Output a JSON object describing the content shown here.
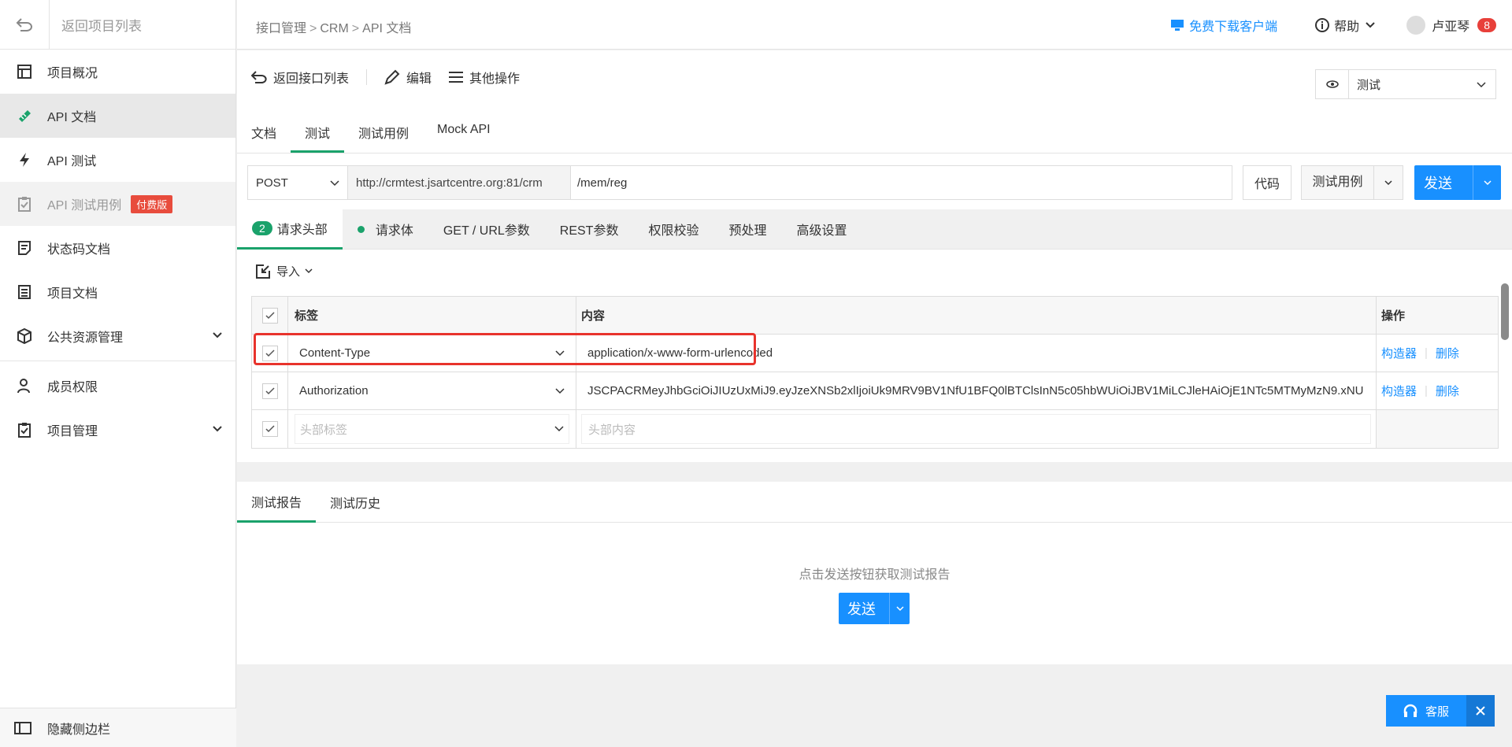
{
  "sidebar": {
    "back_label": "返回项目列表",
    "items": [
      {
        "label": "项目概况"
      },
      {
        "label": "API 文档"
      },
      {
        "label": "API 测试"
      },
      {
        "label": "API 测试用例",
        "badge": "付费版"
      },
      {
        "label": "状态码文档"
      },
      {
        "label": "项目文档"
      },
      {
        "label": "公共资源管理"
      },
      {
        "label": "成员权限"
      },
      {
        "label": "项目管理"
      }
    ],
    "hide_label": "隐藏侧边栏"
  },
  "header": {
    "breadcrumb": [
      "接口管理",
      "CRM",
      "API 文档"
    ],
    "download_label": "免费下载客户端",
    "help_label": "帮助",
    "user_name": "卢亚琴",
    "notification_count": "8"
  },
  "toolbar": {
    "back_label": "返回接口列表",
    "edit_label": "编辑",
    "more_label": "其他操作",
    "env_value": "测试"
  },
  "tabs": [
    "文档",
    "测试",
    "测试用例",
    "Mock API"
  ],
  "request": {
    "method": "POST",
    "base_url": "http://crmtest.jsartcentre.org:81/crm",
    "path": "/mem/reg",
    "code_label": "代码",
    "case_label": "测试用例",
    "send_label": "发送"
  },
  "sub_tabs": {
    "header_count": "2",
    "header_label": "请求头部",
    "body_label": "请求体",
    "others": [
      "GET / URL参数",
      "REST参数",
      "权限校验",
      "预处理",
      "高级设置"
    ]
  },
  "import_label": "导入",
  "headers_table": {
    "columns": [
      "标签",
      "内容",
      "操作"
    ],
    "rows": [
      {
        "label": "Content-Type",
        "content": "application/x-www-form-urlencoded"
      },
      {
        "label": "Authorization",
        "content": "JSCPACRMeyJhbGciOiJIUzUxMiJ9.eyJzeXNSb2xlIjoiUk9MRV9BV1NfU1BFQ0lBTClsInN5c05hbWUiOiJBV1MiLCJleHAiOjE1NTc5MTMyMzN9.xNU"
      }
    ],
    "builder_label": "构造器",
    "delete_label": "删除",
    "placeholder_label": "头部标签",
    "placeholder_content": "头部内容"
  },
  "report": {
    "tabs": [
      "测试报告",
      "测试历史"
    ],
    "hint": "点击发送按钮获取测试报告",
    "send_label": "发送"
  },
  "service_label": "客服",
  "colors": {
    "primary": "#1890ff",
    "accent_green": "#1aa26b",
    "danger": "#e8332c"
  }
}
